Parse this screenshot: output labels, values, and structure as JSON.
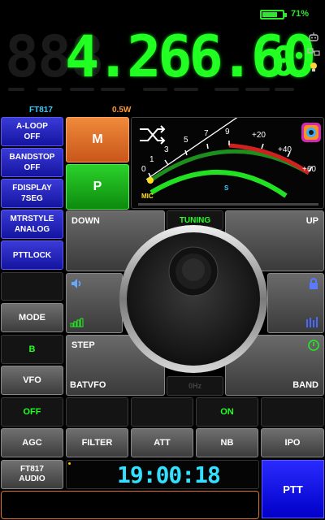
{
  "status": {
    "battery_percent_text": "71%",
    "battery_level": 0.71
  },
  "frequency": {
    "ghost_digits": "888",
    "main": "4.266.60",
    "small_digit": "0"
  },
  "radio": {
    "model": "FT817",
    "power": "0.5W"
  },
  "left_buttons": [
    {
      "label1": "A-LOOP",
      "label2": "OFF"
    },
    {
      "label1": "BANDSTOP",
      "label2": "OFF"
    },
    {
      "label1": "FDISPLAY",
      "label2": "7SEG"
    },
    {
      "label1": "MTRSTYLE",
      "label2": "ANALOG"
    },
    {
      "label1": "PTTLOCK",
      "label2": ""
    }
  ],
  "mp": {
    "m_label": "M",
    "p_label": "P"
  },
  "meter": {
    "scale": [
      "0",
      "1",
      "3",
      "5",
      "7",
      "9",
      "+20",
      "+40",
      "+60"
    ],
    "mic_label": "MIC",
    "s_label": "S"
  },
  "tuning": {
    "down_label": "DOWN",
    "up_label": "UP",
    "tuning_label": "TUNING",
    "step_label": "STEP",
    "batvfo_label": "BATVFO",
    "band_label": "BAND",
    "hz_label": "0Hz"
  },
  "side_controls": {
    "mode_label": "MODE",
    "b_label": "B",
    "vfo_label": "VFO"
  },
  "row1": {
    "off_label": "OFF",
    "on_label": "ON"
  },
  "row2": [
    "AGC",
    "FILTER",
    "ATT",
    "NB",
    "IPO"
  ],
  "bottom": {
    "audio_label1": "FT817",
    "audio_label2": "AUDIO",
    "clock": "19:00:18",
    "ptt_label": "PTT"
  },
  "colors": {
    "green": "#22ff22",
    "blue": "#1414a0",
    "orange": "#e07028",
    "cyan": "#33ccff"
  }
}
